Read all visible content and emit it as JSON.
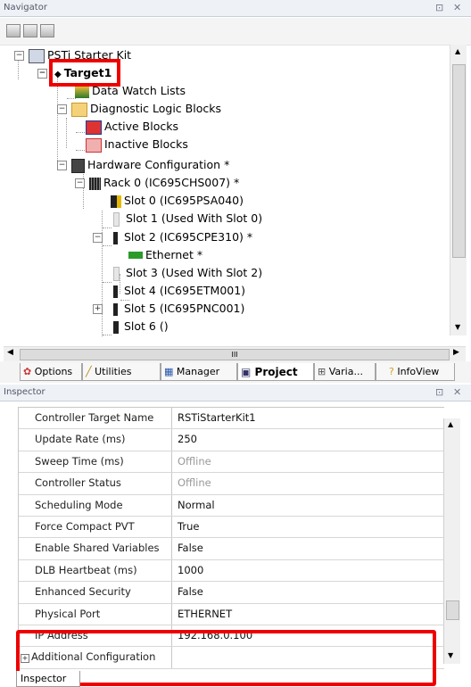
{
  "navigator": {
    "title": "Navigator",
    "pin": "⊡",
    "close": "✕",
    "tree": {
      "root": "PSTi Starter Kit",
      "target": "Target1",
      "data_watch": "Data Watch Lists",
      "dlb": "Diagnostic Logic Blocks",
      "active_blocks": "Active Blocks",
      "inactive_blocks": "Inactive Blocks",
      "hwconfig": "Hardware Configuration *",
      "rack": "Rack 0 (IC695CHS007) *",
      "slot0": "Slot 0 (IC695PSA040)",
      "slot1": "Slot 1 (Used With Slot 0)",
      "slot2": "Slot 2 (IC695CPE310) *",
      "ethernet": "Ethernet *",
      "slot3": "Slot 3 (Used With Slot 2)",
      "slot4": "Slot 4 (IC695ETM001)",
      "slot5": "Slot 5 (IC695PNC001)",
      "slot6": "Slot 6 ()"
    },
    "hscroll_grip": "III"
  },
  "tabs": {
    "options": "Options",
    "utilities": "Utilities",
    "manager": "Manager",
    "project": "Project",
    "variables": "Varia...",
    "infoview": "InfoView"
  },
  "inspector": {
    "title": "Inspector",
    "pin": "⊡",
    "close": "✕",
    "rows": [
      {
        "key": "Controller Target Name",
        "value": "RSTiStarterKit1"
      },
      {
        "key": "Update Rate (ms)",
        "value": "250"
      },
      {
        "key": "Sweep Time (ms)",
        "value": "Offline"
      },
      {
        "key": "Controller Status",
        "value": "Offline"
      },
      {
        "key": "Scheduling Mode",
        "value": "Normal"
      },
      {
        "key": "Force Compact PVT",
        "value": "True"
      },
      {
        "key": "Enable Shared Variables",
        "value": "False"
      },
      {
        "key": "DLB Heartbeat (ms)",
        "value": "1000"
      },
      {
        "key": "Enhanced Security",
        "value": "False"
      },
      {
        "key": "Physical Port",
        "value": "ETHERNET"
      },
      {
        "key": "IP Address",
        "value": "192.168.0.100"
      },
      {
        "key": "Additional Configuration",
        "value": ""
      }
    ],
    "bottom_tab": "Inspector"
  },
  "colors": {
    "highlight": "#ee0000",
    "panel_title_bg": "#eef1f6"
  }
}
